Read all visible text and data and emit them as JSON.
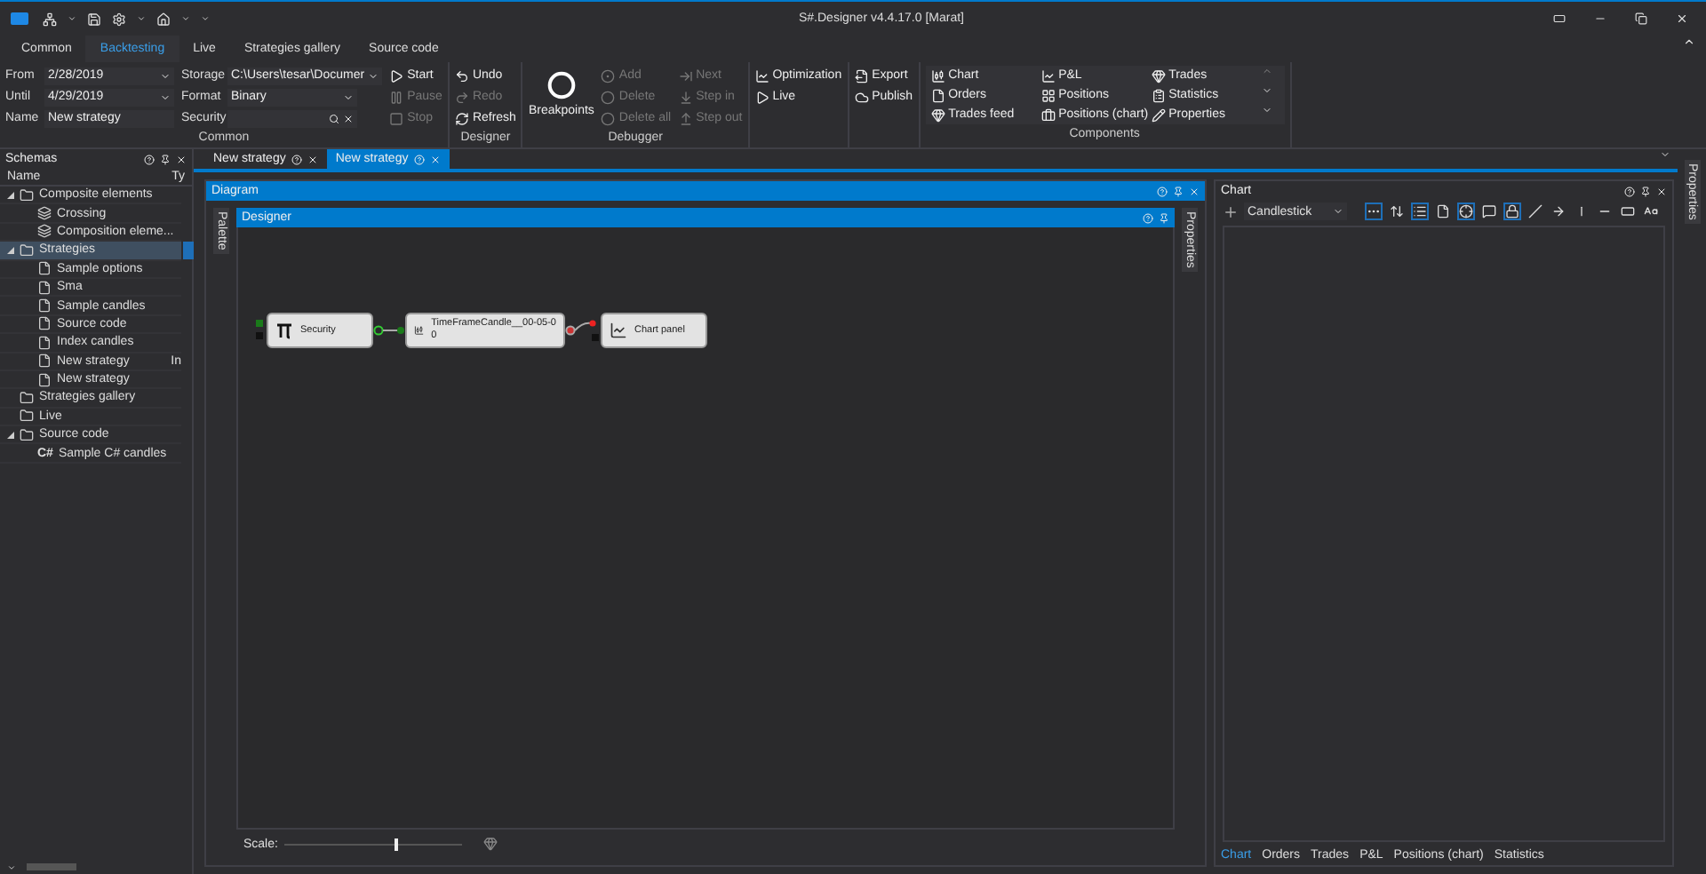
{
  "window": {
    "title": "S#.Designer v4.4.17.0 [Marat]"
  },
  "ribbon_tabs": [
    {
      "label": "Common",
      "selected": false
    },
    {
      "label": "Backtesting",
      "selected": true
    },
    {
      "label": "Live",
      "selected": false
    },
    {
      "label": "Strategies gallery",
      "selected": false
    },
    {
      "label": "Source code",
      "selected": false
    }
  ],
  "ribbon": {
    "common": {
      "label": "Common",
      "fields_left": [
        {
          "label": "From",
          "value": "2/28/2019",
          "kind": "dropdown"
        },
        {
          "label": "Until",
          "value": "4/29/2019",
          "kind": "dropdown"
        },
        {
          "label": "Name",
          "value": "New strategy",
          "kind": "text"
        }
      ],
      "fields_right": [
        {
          "label": "Storage",
          "value": "C:\\Users\\tesar\\Documer",
          "kind": "dropdown"
        },
        {
          "label": "Format",
          "value": "Binary",
          "kind": "dropdown"
        },
        {
          "label": "Security",
          "kind": "search"
        }
      ],
      "commands": [
        {
          "label": "Start",
          "disabled": false
        },
        {
          "label": "Pause",
          "disabled": true
        },
        {
          "label": "Stop",
          "disabled": true
        }
      ]
    },
    "designer": {
      "label": "Designer",
      "commands": [
        {
          "label": "Undo",
          "disabled": false
        },
        {
          "label": "Redo",
          "disabled": true
        },
        {
          "label": "Refresh",
          "disabled": false
        }
      ]
    },
    "debugger": {
      "label": "Debugger",
      "breakpoints": "Breakpoints",
      "breakpoint_commands": [
        {
          "label": "Add",
          "disabled": true
        },
        {
          "label": "Delete",
          "disabled": true
        },
        {
          "label": "Delete all",
          "disabled": true
        }
      ],
      "step_commands": [
        {
          "label": "Next",
          "disabled": true
        },
        {
          "label": "Step in",
          "disabled": true
        },
        {
          "label": "Step out",
          "disabled": true
        }
      ]
    },
    "run_commands": [
      {
        "label": "Optimization",
        "disabled": false
      },
      {
        "label": "Live",
        "disabled": false
      }
    ],
    "share_commands": [
      {
        "label": "Export",
        "disabled": false
      },
      {
        "label": "Publish",
        "disabled": false
      }
    ],
    "components": {
      "label": "Components",
      "items": [
        "Chart",
        "P&L",
        "Trades",
        "Orders",
        "Positions",
        "Statistics",
        "Trades feed",
        "Positions (chart)",
        "Properties"
      ]
    }
  },
  "schemas": {
    "title": "Schemas",
    "columns": [
      "Name",
      "Ty"
    ],
    "tree": [
      {
        "label": "Composite elements",
        "kind": "folder",
        "expanded": true,
        "selected": false,
        "children": [
          {
            "label": "Crossing",
            "kind": "composite",
            "selected": false
          },
          {
            "label": "Composition eleme...",
            "kind": "composite",
            "selected": false
          }
        ]
      },
      {
        "label": "Strategies",
        "kind": "folder",
        "expanded": true,
        "selected": true,
        "children": [
          {
            "label": "Sample options",
            "kind": "document",
            "selected": false
          },
          {
            "label": "Sma",
            "kind": "document",
            "selected": false
          },
          {
            "label": "Sample candles",
            "kind": "document",
            "selected": false
          },
          {
            "label": "Source code",
            "kind": "document",
            "selected": false
          },
          {
            "label": "Index candles",
            "kind": "document",
            "selected": false
          },
          {
            "label": "New strategy",
            "kind": "document",
            "selected": false,
            "column_2": "In"
          },
          {
            "label": "New strategy",
            "kind": "document",
            "selected": false
          }
        ]
      },
      {
        "label": "Strategies gallery",
        "kind": "folder",
        "selected": false
      },
      {
        "label": "Live",
        "kind": "folder",
        "selected": false
      },
      {
        "label": "Source code",
        "kind": "folder",
        "expanded": true,
        "selected": false,
        "children": [
          {
            "label": "Sample C# candles",
            "kind": "code",
            "icon_text": "C#",
            "selected": false
          }
        ]
      }
    ]
  },
  "document_tabs": [
    {
      "label": "New strategy",
      "selected": false
    },
    {
      "label": "New strategy",
      "selected": true
    }
  ],
  "diagram": {
    "title": "Diagram",
    "left_tab": "Palette",
    "right_tab": "Properties",
    "designer_title": "Designer",
    "nodes": [
      {
        "kind": "source",
        "title": "Security"
      },
      {
        "kind": "candles",
        "title": "TimeFrameCandle__00-05-0",
        "subtitle": "0"
      },
      {
        "kind": "chart",
        "title": "Chart panel"
      }
    ],
    "scale": {
      "label": "Scale:",
      "level": 0.62
    }
  },
  "chart": {
    "title": "Chart",
    "series": "Candlestick",
    "toolbar": [
      {
        "kind": "legend",
        "on": true
      },
      {
        "kind": "sort",
        "on": false
      },
      {
        "kind": "list",
        "on": true
      },
      {
        "kind": "page",
        "on": false
      },
      {
        "kind": "crosshair",
        "on": true
      },
      {
        "kind": "comment",
        "on": false
      },
      {
        "kind": "corner",
        "on": true
      },
      {
        "kind": "line",
        "on": false
      },
      {
        "kind": "arrow",
        "on": false
      },
      {
        "kind": "vline",
        "on": false
      },
      {
        "kind": "hline",
        "on": false
      },
      {
        "kind": "rect",
        "on": false
      },
      {
        "kind": "text",
        "on": false
      }
    ],
    "bottom_tabs": [
      {
        "label": "Chart",
        "selected": true
      },
      {
        "label": "Orders",
        "selected": false
      },
      {
        "label": "Trades",
        "selected": false
      },
      {
        "label": "P&L",
        "selected": false
      },
      {
        "label": "Positions (chart)",
        "selected": false
      },
      {
        "label": "Statistics",
        "selected": false
      }
    ]
  },
  "side_tab": "Properties"
}
